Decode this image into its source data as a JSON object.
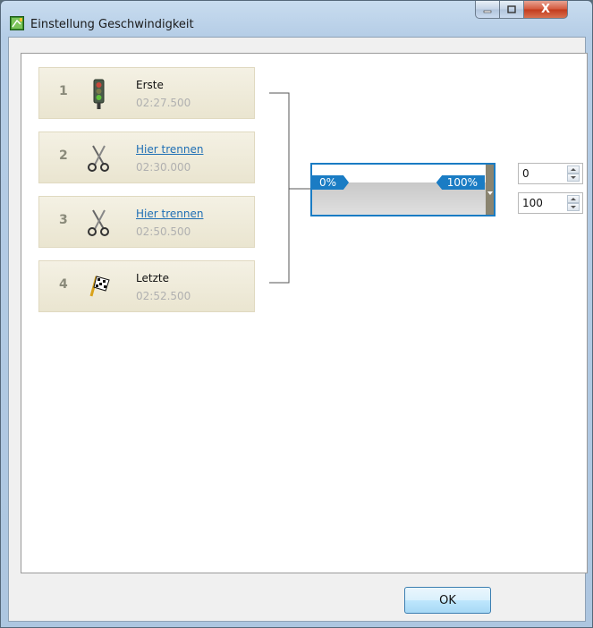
{
  "window": {
    "title": "Einstellung Geschwindigkeit",
    "close_symbol": "X"
  },
  "items": [
    {
      "number": "1",
      "name": "Erste",
      "time": "02:27.500",
      "icon": "traffic-light-icon",
      "link": false
    },
    {
      "number": "2",
      "name": "Hier trennen",
      "time": "02:30.000",
      "icon": "scissors-icon",
      "link": true
    },
    {
      "number": "3",
      "name": "Hier trennen",
      "time": "02:50.500",
      "icon": "scissors-icon",
      "link": true
    },
    {
      "number": "4",
      "name": "Letzte",
      "time": "02:52.500",
      "icon": "checkered-flag-icon",
      "link": false
    }
  ],
  "speed_range": {
    "min_label": "0%",
    "max_label": "100%",
    "min_value": "0",
    "max_value": "100"
  },
  "buttons": {
    "ok_label": "OK"
  },
  "colors": {
    "accent": "#1a7cc4",
    "link": "#1f6fb5",
    "item_bg": "#eee9d6"
  }
}
